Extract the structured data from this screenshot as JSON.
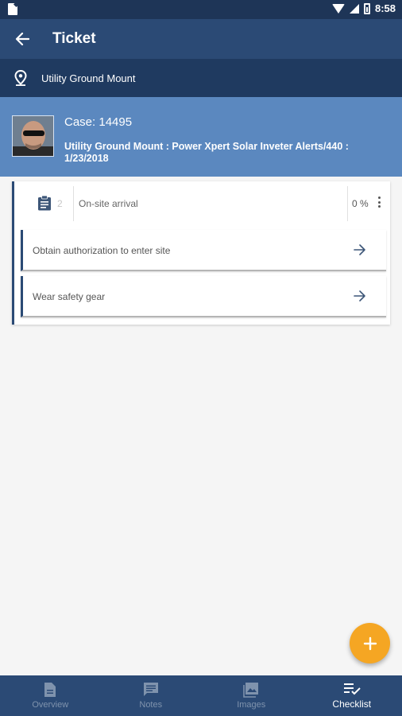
{
  "status_bar": {
    "time": "8:58"
  },
  "app_bar": {
    "title": "Ticket"
  },
  "location": {
    "label": "Utility Ground Mount"
  },
  "case": {
    "number_label": "Case: 14495",
    "description": "Utility Ground Mount : Power Xpert Solar Inveter Alerts/440 : 1/23/2018"
  },
  "checklist": {
    "group": {
      "count": "2",
      "title": "On-site arrival",
      "percent": "0 %"
    },
    "tasks": [
      {
        "label": "Obtain authorization to enter site"
      },
      {
        "label": "Wear safety gear"
      }
    ]
  },
  "fab": {
    "icon": "plus-icon"
  },
  "bottom_nav": {
    "items": [
      {
        "label": "Overview",
        "icon": "document-icon",
        "active": false
      },
      {
        "label": "Notes",
        "icon": "comment-icon",
        "active": false
      },
      {
        "label": "Images",
        "icon": "image-icon",
        "active": false
      },
      {
        "label": "Checklist",
        "icon": "checklist-icon",
        "active": true
      }
    ]
  },
  "colors": {
    "status_bar": "#1e3557",
    "app_bar": "#2b4a75",
    "location_bar": "#1f3a60",
    "case_header": "#5b88bf",
    "fab": "#f5a623"
  }
}
